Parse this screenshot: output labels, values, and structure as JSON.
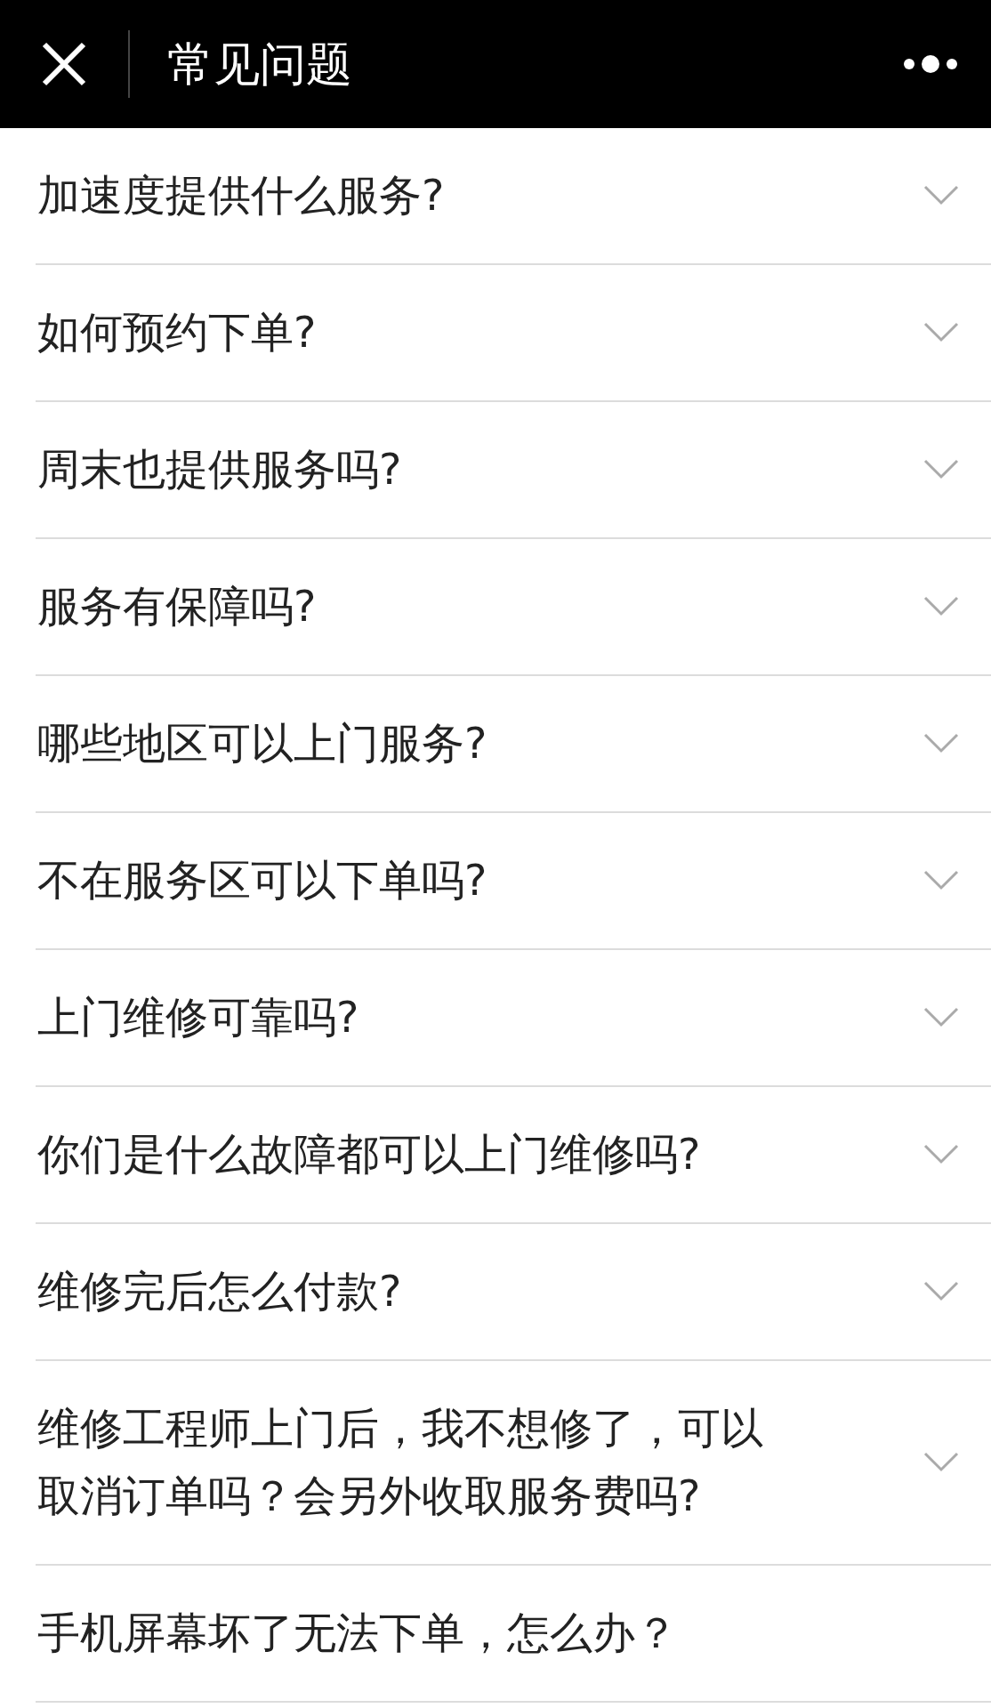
{
  "window": {
    "title": "常见问题"
  },
  "faq": [
    {
      "question": "加速度提供什么服务?",
      "expanded": false
    },
    {
      "question": "如何预约下单?",
      "expanded": false
    },
    {
      "question": "周末也提供服务吗?",
      "expanded": false
    },
    {
      "question": "服务有保障吗?",
      "expanded": false
    },
    {
      "question": "哪些地区可以上门服务?",
      "expanded": false
    },
    {
      "question": "不在服务区可以下单吗?",
      "expanded": false
    },
    {
      "question": "上门维修可靠吗?",
      "expanded": false
    },
    {
      "question": "你们是什么故障都可以上门维修吗?",
      "expanded": false
    },
    {
      "question": "维修完后怎么付款?",
      "expanded": false
    },
    {
      "question": "维修工程师上门后，我不想修了，可以取消订单吗？会另外收取服务费吗?",
      "expanded": false
    },
    {
      "question": "手机屏幕坏了无法下单，怎么办？"
    }
  ]
}
